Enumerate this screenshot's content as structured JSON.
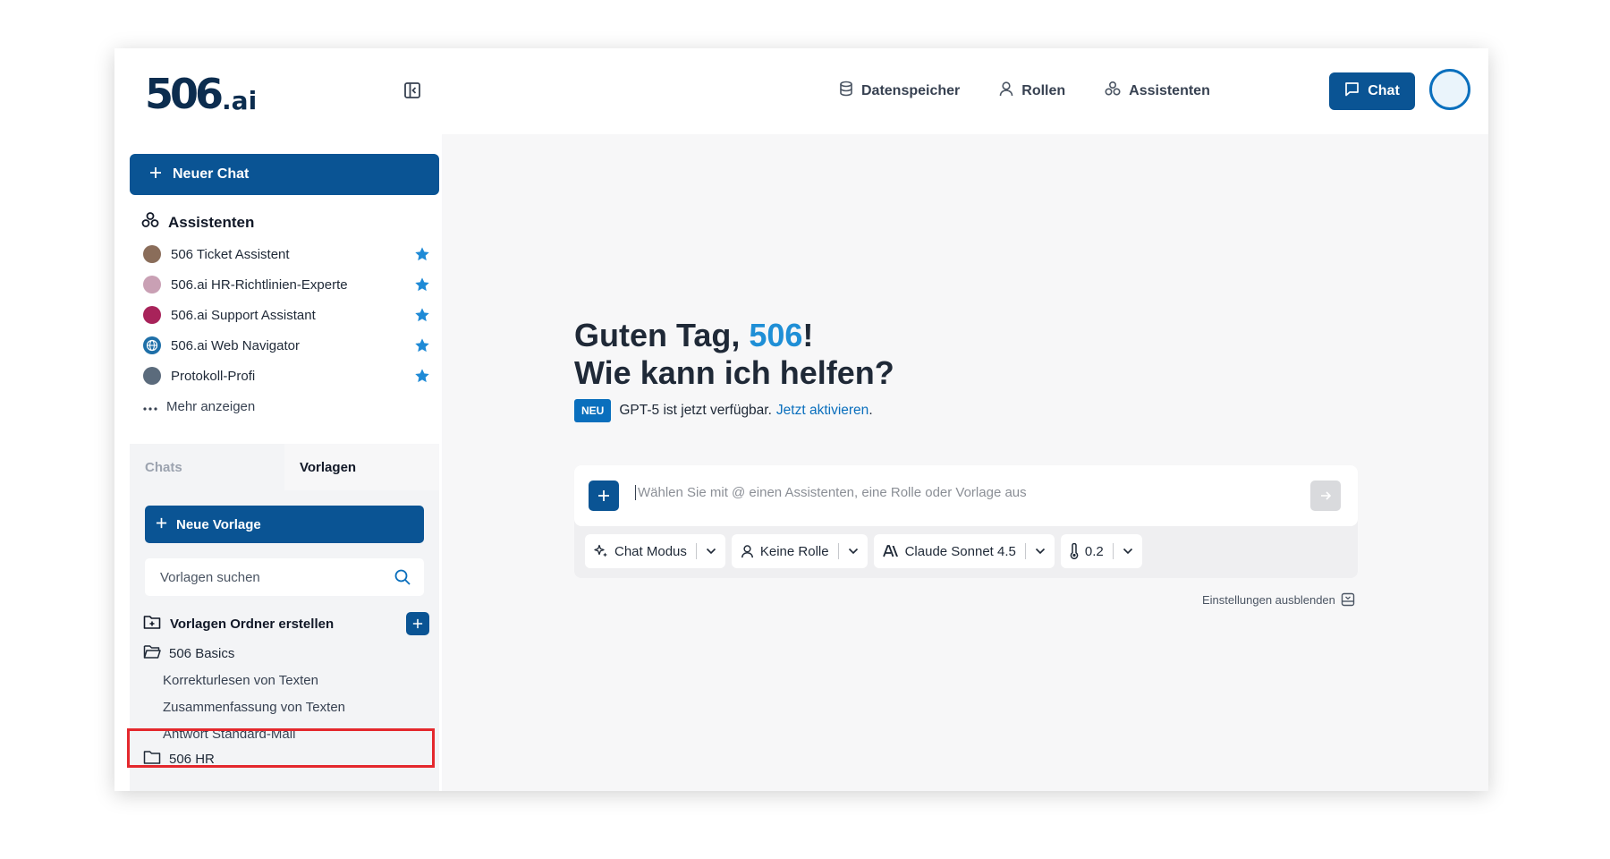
{
  "logo": {
    "main": "506",
    "suffix": ".ai"
  },
  "topnav": {
    "items": [
      {
        "label": "Datenspeicher",
        "icon": "database-icon"
      },
      {
        "label": "Rollen",
        "icon": "user-icon"
      },
      {
        "label": "Assistenten",
        "icon": "assistants-icon"
      }
    ],
    "chat_label": "Chat"
  },
  "sidebar": {
    "new_chat_label": "Neuer Chat",
    "assistants_title": "Assistenten",
    "assistants": [
      {
        "label": "506 Ticket Assistent",
        "avatar_color": "#8a6d5a",
        "starred": true
      },
      {
        "label": "506.ai HR-Richtlinien-Experte",
        "avatar_color": "#c9a0b4",
        "starred": true
      },
      {
        "label": "506.ai Support Assistant",
        "avatar_color": "#a8235a",
        "starred": true
      },
      {
        "label": "506.ai Web Navigator",
        "avatar_color": "#1e6fa8",
        "starred": true
      },
      {
        "label": "Protokoll-Profi",
        "avatar_color": "#5b6b7c",
        "starred": true
      }
    ],
    "more_label": "Mehr anzeigen",
    "tabs": [
      {
        "label": "Chats",
        "active": false
      },
      {
        "label": "Vorlagen",
        "active": true
      }
    ],
    "new_template_label": "Neue Vorlage",
    "search_placeholder": "Vorlagen suchen",
    "create_folder_label": "Vorlagen Ordner erstellen",
    "folders": [
      {
        "label": "506 Basics",
        "items": [
          "Korrekturlesen von Texten",
          "Zusammenfassung von Texten",
          "Antwort Standard-Mail"
        ]
      },
      {
        "label": "506 HR",
        "items": []
      }
    ]
  },
  "main": {
    "greeting_prefix": "Guten Tag, ",
    "greeting_name": "506",
    "greeting_suffix": "!",
    "greeting_line2": "Wie kann ich helfen?",
    "badge": "NEU",
    "news_text": "GPT-5 ist jetzt verfügbar.",
    "news_link": "Jetzt aktivieren",
    "news_end": ".",
    "prompt_placeholder": "Wählen Sie mit @ einen Assistenten, eine Rolle oder Vorlage aus",
    "options": {
      "mode": "Chat Modus",
      "role": "Keine Rolle",
      "model": "Claude Sonnet 4.5",
      "temperature": "0.2"
    },
    "hide_settings_label": "Einstellungen ausblenden"
  },
  "colors": {
    "primary": "#0a5494",
    "accent": "#1f8fd6",
    "highlight": "#e4282d",
    "star": "#1e8ad6"
  }
}
